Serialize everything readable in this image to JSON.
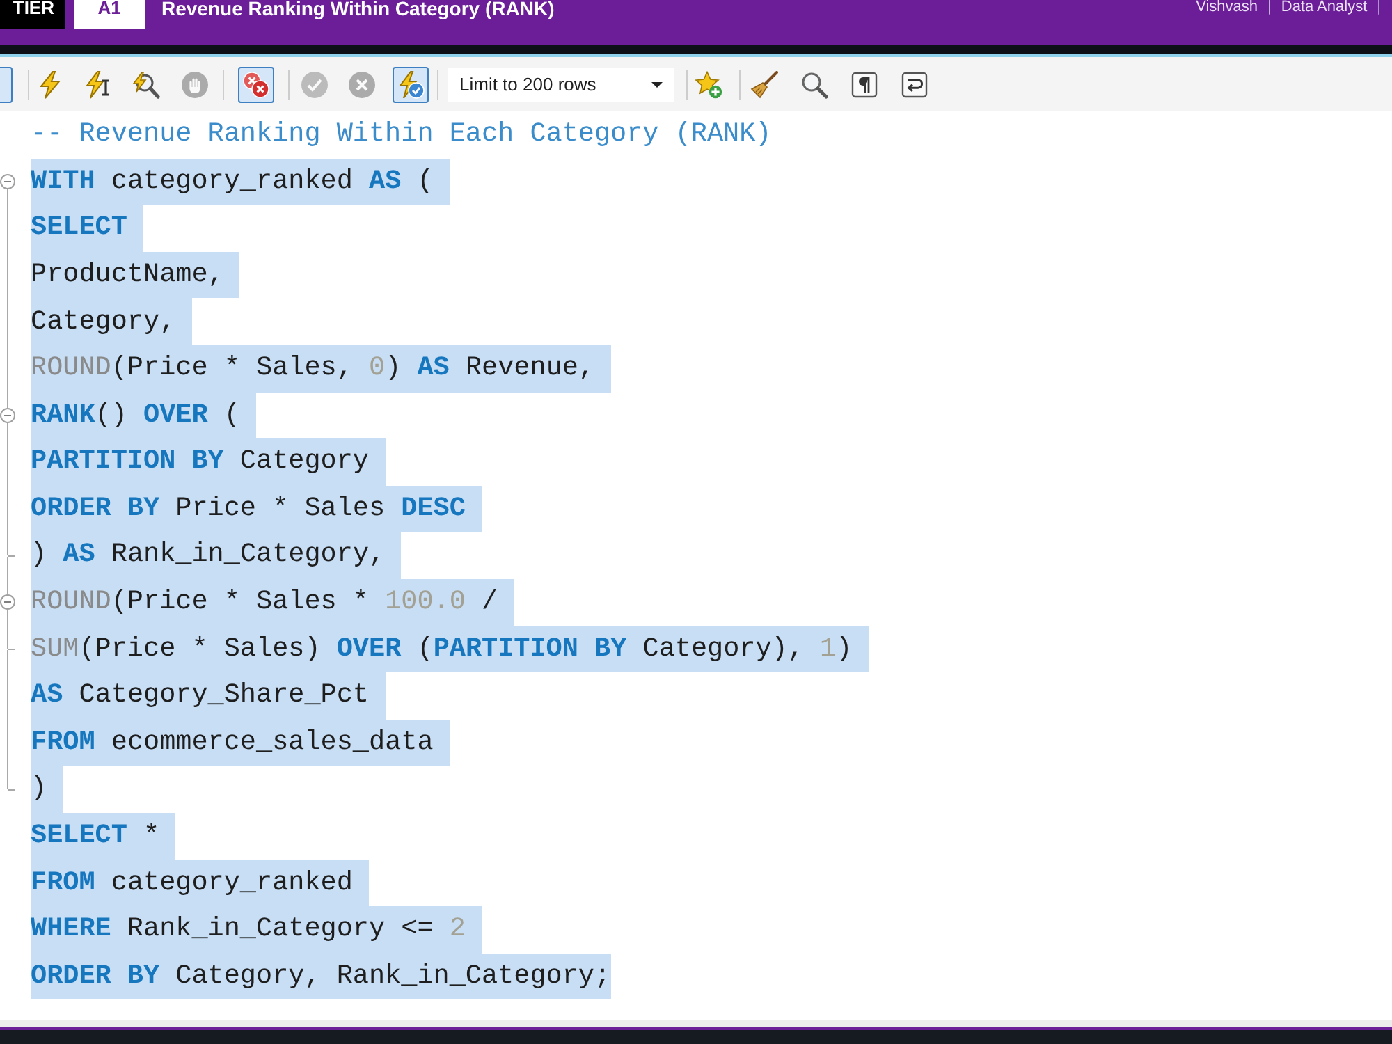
{
  "header": {
    "plan": "TIER",
    "code": "A1",
    "title": "Revenue Ranking Within Category (RANK)",
    "user_info": [
      {
        "kind": "text",
        "text": "Vishvash"
      },
      {
        "kind": "separator",
        "text": "|"
      },
      {
        "kind": "text",
        "text": "Data Analyst"
      },
      {
        "kind": "separator",
        "text": "|"
      }
    ]
  },
  "toolbar": {
    "items": [
      {
        "kind": "toggle",
        "pressed": true
      },
      {
        "kind": "separator"
      },
      {
        "kind": "button",
        "disabled": false
      },
      {
        "kind": "button",
        "disabled": false
      },
      {
        "kind": "button",
        "disabled": false
      },
      {
        "kind": "button",
        "disabled": true
      },
      {
        "kind": "separator"
      },
      {
        "kind": "toggle",
        "pressed": true
      },
      {
        "kind": "separator"
      },
      {
        "kind": "button",
        "disabled": true
      },
      {
        "kind": "button",
        "disabled": true
      },
      {
        "kind": "toggle",
        "pressed": true
      },
      {
        "kind": "separator"
      },
      {
        "kind": "dropdown",
        "value": "Limit to 200 rows"
      },
      {
        "kind": "separator"
      },
      {
        "kind": "button",
        "disabled": false
      },
      {
        "kind": "separator"
      },
      {
        "kind": "button",
        "disabled": false
      },
      {
        "kind": "button",
        "disabled": false
      },
      {
        "kind": "button",
        "disabled": false
      },
      {
        "kind": "button",
        "disabled": false
      }
    ]
  },
  "editor": {
    "lines": [
      {
        "kind": "plain",
        "selected": false,
        "tokens": [
          {
            "kind": "comment",
            "text": "-- Revenue Ranking Within Each Category (RANK)"
          }
        ]
      },
      {
        "kind": "opener",
        "selected": true,
        "tokens": [
          {
            "kind": "keyword",
            "text": "WITH"
          },
          {
            "kind": "text",
            "text": " category_ranked "
          },
          {
            "kind": "keyword",
            "text": "AS"
          },
          {
            "kind": "text",
            "text": " ("
          }
        ]
      },
      {
        "kind": "plain",
        "selected": true,
        "tokens": [
          {
            "kind": "keyword",
            "text": "SELECT"
          }
        ]
      },
      {
        "kind": "plain",
        "selected": true,
        "tokens": [
          {
            "kind": "text",
            "text": "ProductName,"
          }
        ]
      },
      {
        "kind": "plain",
        "selected": true,
        "tokens": [
          {
            "kind": "text",
            "text": "Category,"
          }
        ]
      },
      {
        "kind": "plain",
        "selected": true,
        "tokens": [
          {
            "kind": "function",
            "text": "ROUND"
          },
          {
            "kind": "text",
            "text": "(Price * Sales, "
          },
          {
            "kind": "number",
            "text": "0"
          },
          {
            "kind": "text",
            "text": ") "
          },
          {
            "kind": "keyword",
            "text": "AS"
          },
          {
            "kind": "text",
            "text": " Revenue,"
          }
        ]
      },
      {
        "kind": "opener",
        "selected": true,
        "tokens": [
          {
            "kind": "keyword",
            "text": "RANK"
          },
          {
            "kind": "text",
            "text": "() "
          },
          {
            "kind": "keyword",
            "text": "OVER"
          },
          {
            "kind": "text",
            "text": " ("
          }
        ]
      },
      {
        "kind": "plain",
        "selected": true,
        "tokens": [
          {
            "kind": "keyword",
            "text": "PARTITION BY"
          },
          {
            "kind": "text",
            "text": " Category"
          }
        ]
      },
      {
        "kind": "plain",
        "selected": true,
        "tokens": [
          {
            "kind": "keyword",
            "text": "ORDER BY"
          },
          {
            "kind": "text",
            "text": " Price * Sales "
          },
          {
            "kind": "keyword",
            "text": "DESC"
          }
        ]
      },
      {
        "kind": "closer",
        "selected": true,
        "tokens": [
          {
            "kind": "text",
            "text": ") "
          },
          {
            "kind": "keyword",
            "text": "AS"
          },
          {
            "kind": "text",
            "text": " Rank_in_Category,"
          }
        ]
      },
      {
        "kind": "opener",
        "selected": true,
        "tokens": [
          {
            "kind": "function",
            "text": "ROUND"
          },
          {
            "kind": "text",
            "text": "(Price * Sales * "
          },
          {
            "kind": "number",
            "text": "100.0"
          },
          {
            "kind": "text",
            "text": " /"
          }
        ]
      },
      {
        "kind": "closer",
        "selected": true,
        "tokens": [
          {
            "kind": "function",
            "text": "SUM"
          },
          {
            "kind": "text",
            "text": "(Price * Sales) "
          },
          {
            "kind": "keyword",
            "text": "OVER"
          },
          {
            "kind": "text",
            "text": " ("
          },
          {
            "kind": "keyword",
            "text": "PARTITION BY"
          },
          {
            "kind": "text",
            "text": " Category), "
          },
          {
            "kind": "number",
            "text": "1"
          },
          {
            "kind": "text",
            "text": ")"
          }
        ]
      },
      {
        "kind": "plain",
        "selected": true,
        "tokens": [
          {
            "kind": "keyword",
            "text": "AS"
          },
          {
            "kind": "text",
            "text": " Category_Share_Pct"
          }
        ]
      },
      {
        "kind": "plain",
        "selected": true,
        "tokens": [
          {
            "kind": "keyword",
            "text": "FROM"
          },
          {
            "kind": "text",
            "text": " ecommerce_sales_data"
          }
        ]
      },
      {
        "kind": "closer",
        "selected": true,
        "tokens": [
          {
            "kind": "text",
            "text": ")"
          }
        ]
      },
      {
        "kind": "plain",
        "selected": true,
        "tokens": [
          {
            "kind": "keyword",
            "text": "SELECT"
          },
          {
            "kind": "text",
            "text": " *"
          }
        ]
      },
      {
        "kind": "plain",
        "selected": true,
        "tokens": [
          {
            "kind": "keyword",
            "text": "FROM"
          },
          {
            "kind": "text",
            "text": " category_ranked"
          }
        ]
      },
      {
        "kind": "plain",
        "selected": true,
        "tokens": [
          {
            "kind": "keyword",
            "text": "WHERE"
          },
          {
            "kind": "text",
            "text": " Rank_in_Category <= "
          },
          {
            "kind": "number",
            "text": "2"
          }
        ]
      },
      {
        "kind": "plain",
        "selected": true,
        "tokens": [
          {
            "kind": "keyword",
            "text": "ORDER BY"
          },
          {
            "kind": "text",
            "text": " Category, Rank_in_Category;"
          }
        ]
      }
    ]
  }
}
